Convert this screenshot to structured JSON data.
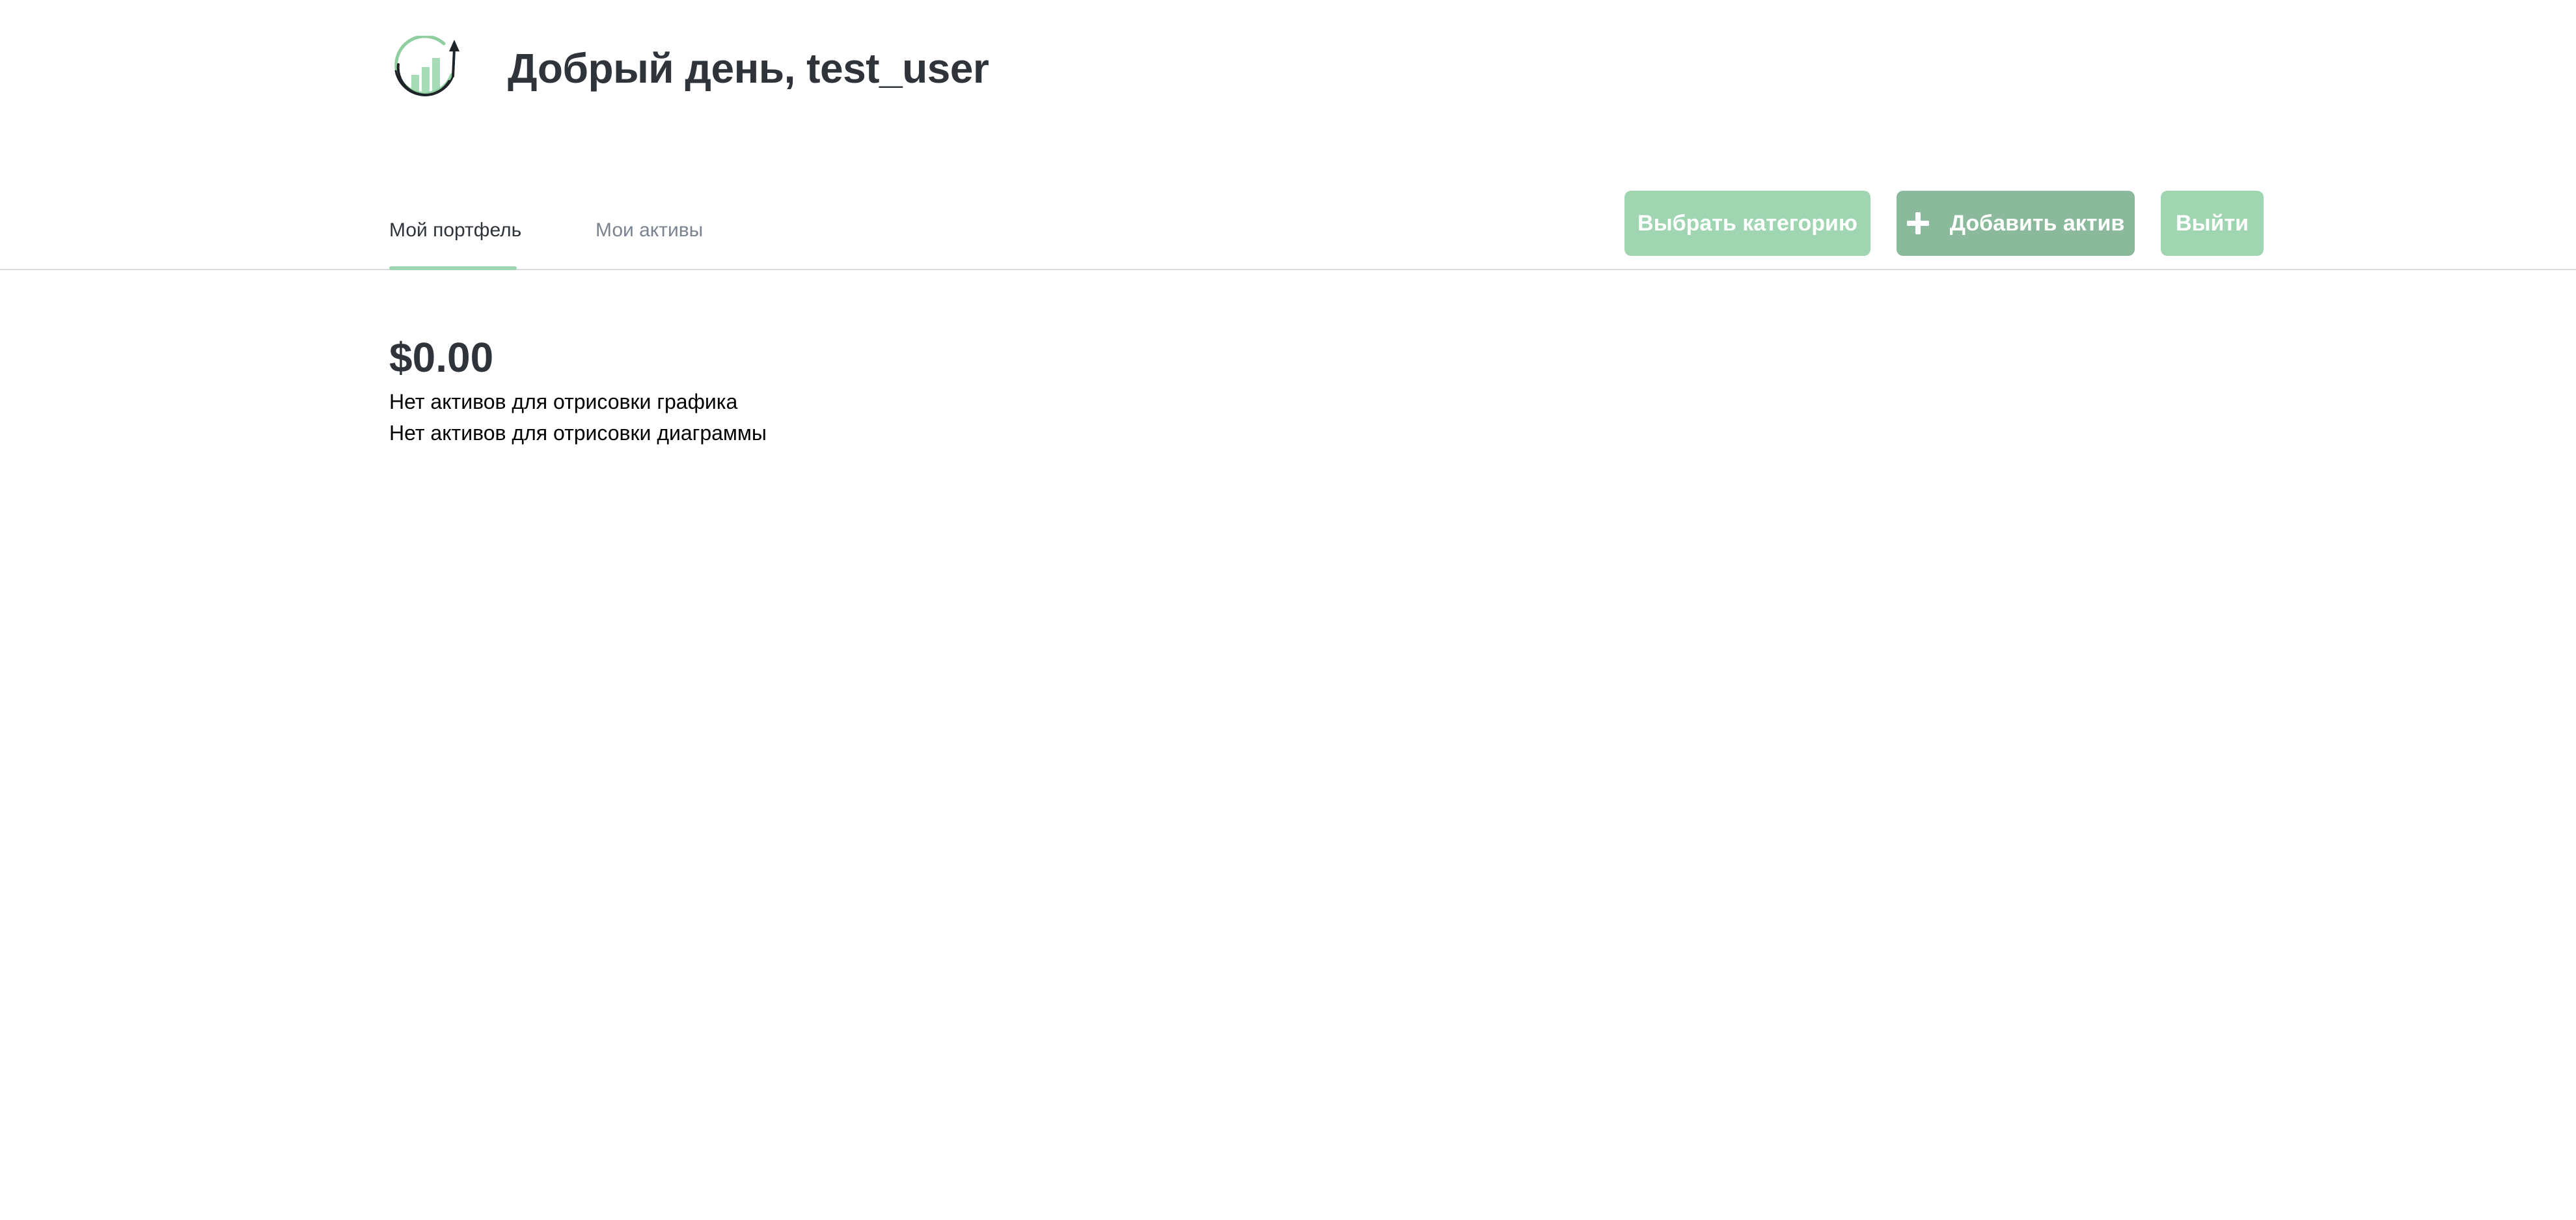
{
  "header": {
    "logo_icon": "growth-chart-logo",
    "greeting": "Добрый день, test_user"
  },
  "tabs": [
    {
      "label": "Мой портфель",
      "active": true
    },
    {
      "label": "Мои активы",
      "active": false
    }
  ],
  "toolbar": {
    "select_category_label": "Выбрать категорию",
    "add_asset_icon": "plus-icon",
    "add_asset_label": "Добавить актив",
    "logout_label": "Выйти"
  },
  "portfolio": {
    "total_value": "$0.00",
    "no_chart_message": "Нет активов для отрисовки графика",
    "no_diagram_message": "Нет активов для отрисовки диаграммы"
  },
  "colors": {
    "accent_light": "#a0d5b1",
    "accent_dark": "#8ab99b",
    "text_primary": "#2e343a",
    "text_muted": "#7a8390"
  }
}
